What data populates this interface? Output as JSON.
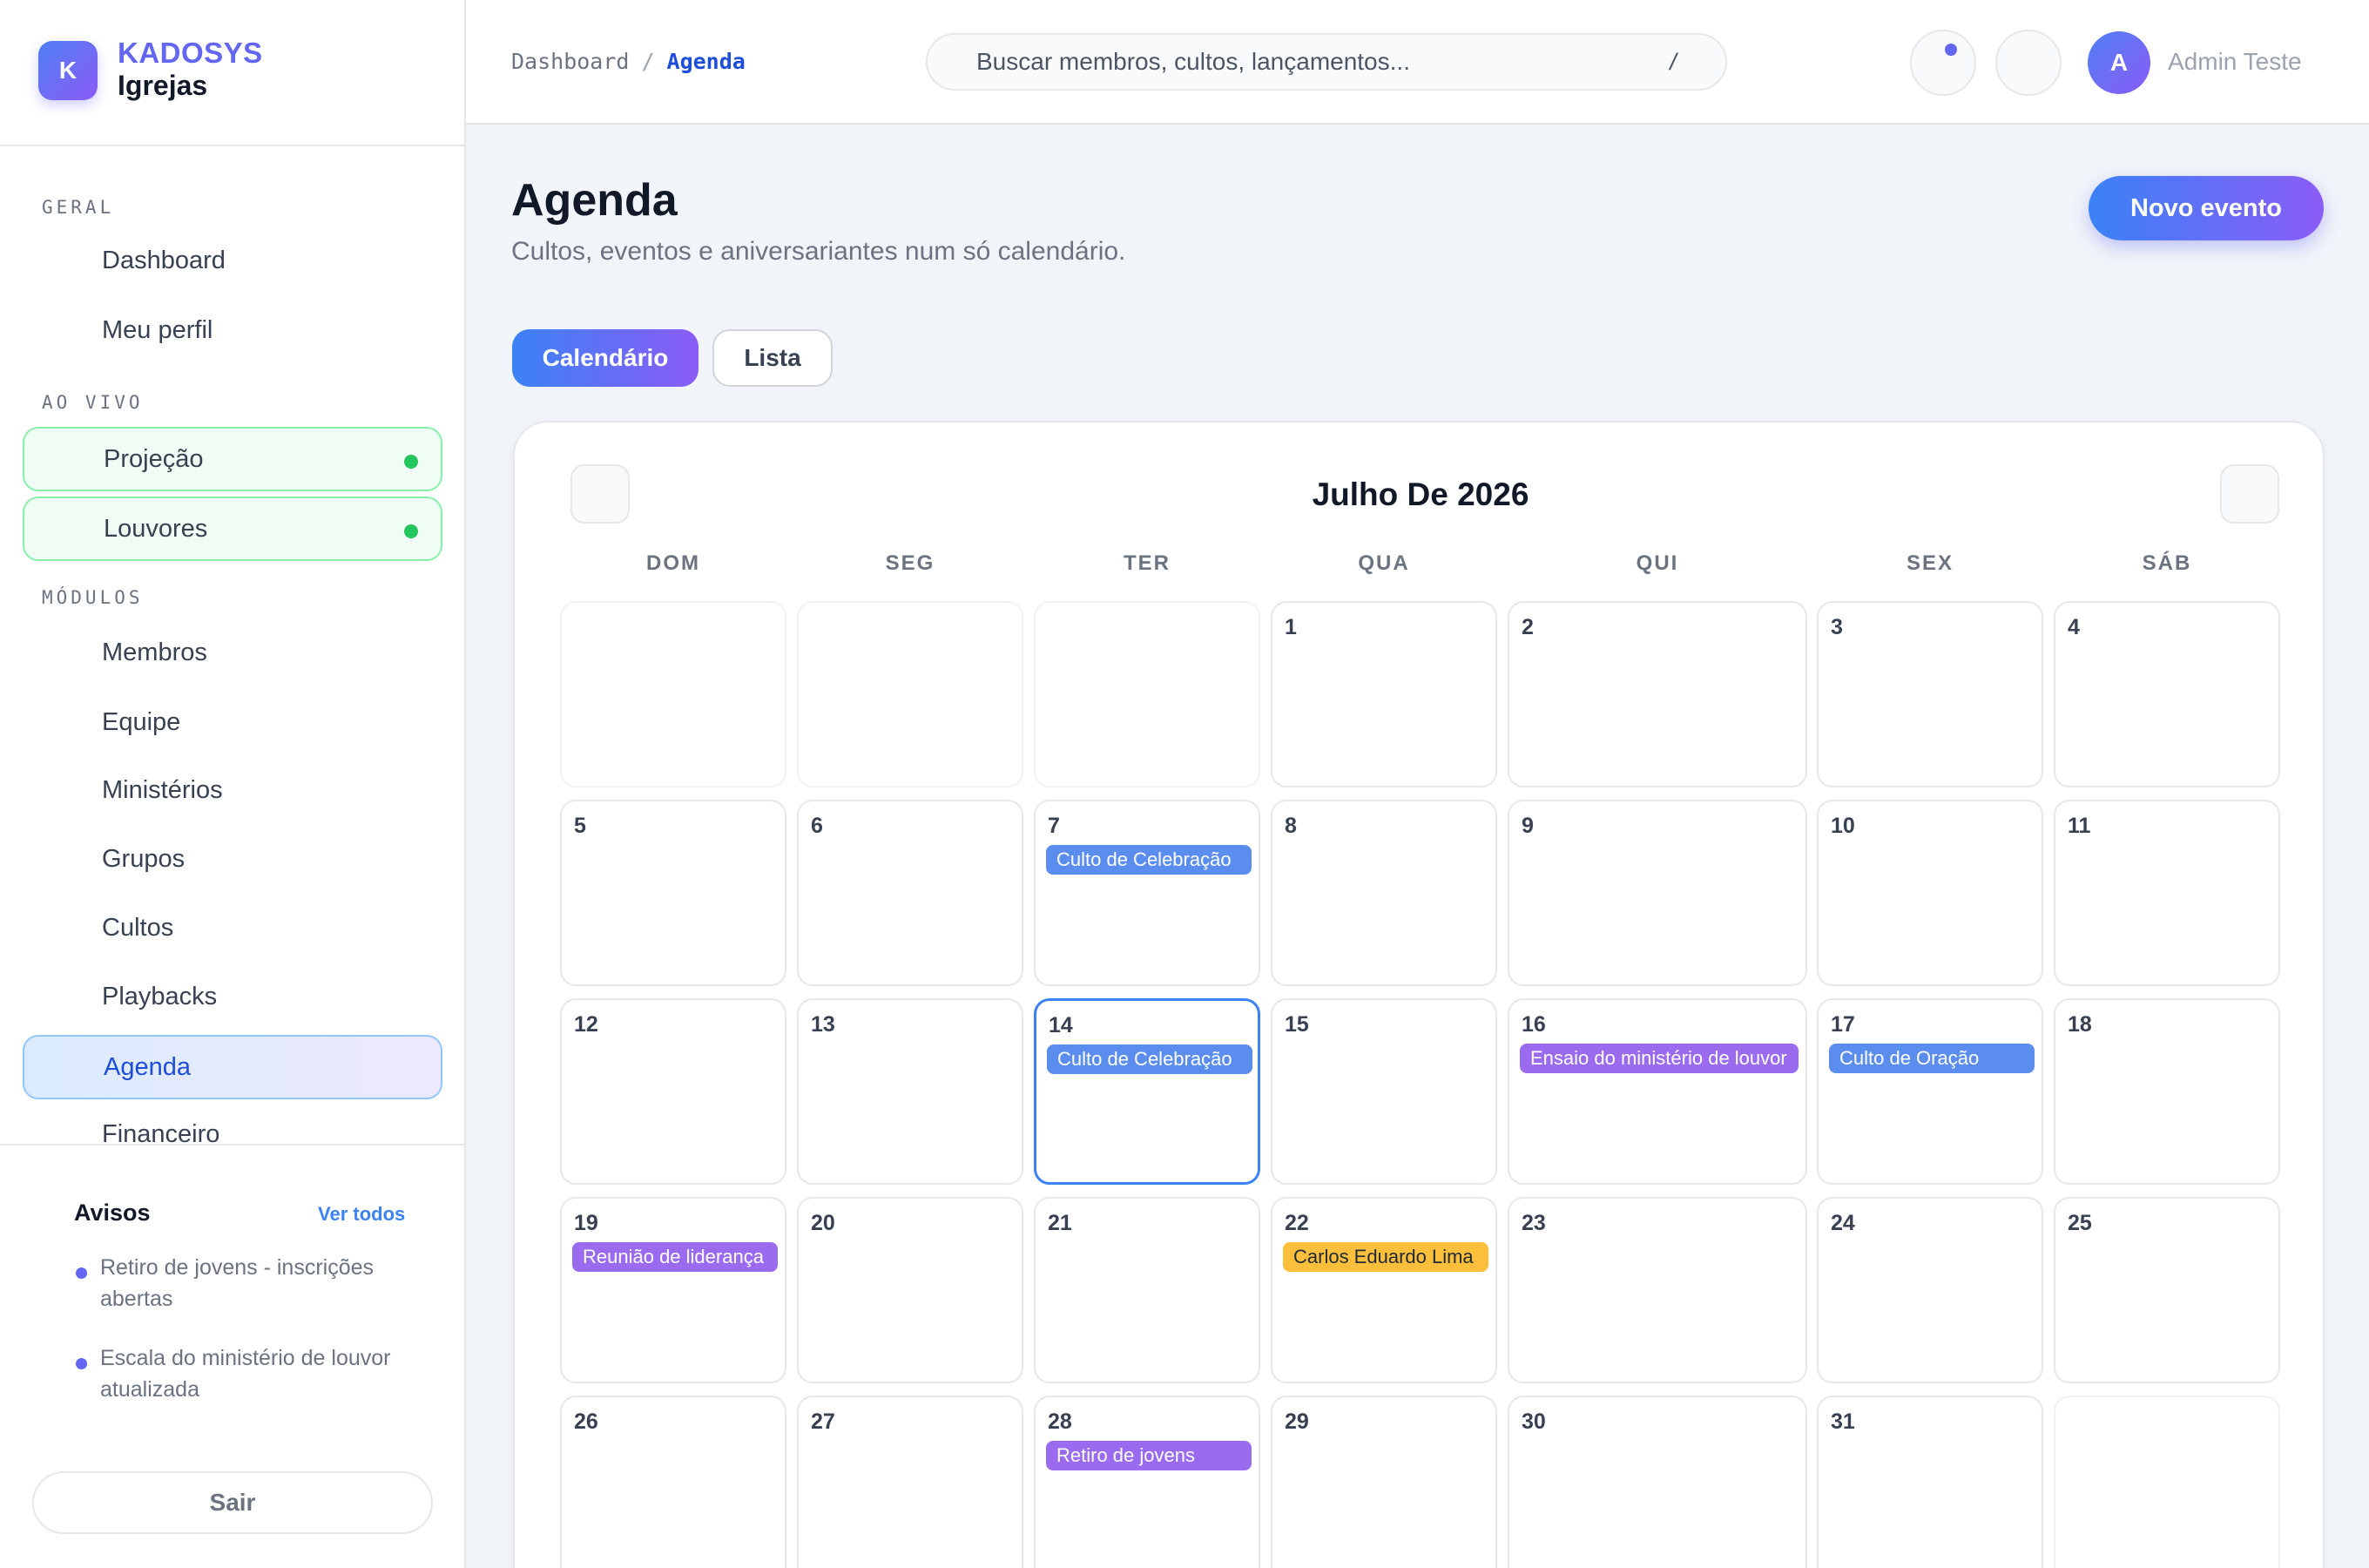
{
  "brand": {
    "logo_letter": "K",
    "name": "KADOSYS",
    "subtitle": "Igrejas"
  },
  "sidebar": {
    "sections": [
      {
        "label": "GERAL",
        "items": [
          {
            "label": "Dashboard",
            "state": "default"
          },
          {
            "label": "Meu perfil",
            "state": "default"
          }
        ]
      },
      {
        "label": "AO VIVO",
        "items": [
          {
            "label": "Projeção",
            "state": "live"
          },
          {
            "label": "Louvores",
            "state": "live"
          }
        ]
      },
      {
        "label": "MÓDULOS",
        "items": [
          {
            "label": "Membros",
            "state": "default"
          },
          {
            "label": "Equipe",
            "state": "default"
          },
          {
            "label": "Ministérios",
            "state": "default"
          },
          {
            "label": "Grupos",
            "state": "default"
          },
          {
            "label": "Cultos",
            "state": "default"
          },
          {
            "label": "Playbacks",
            "state": "default"
          },
          {
            "label": "Agenda",
            "state": "active"
          },
          {
            "label": "Financeiro",
            "state": "default"
          }
        ]
      }
    ],
    "notices": {
      "title": "Avisos",
      "see_all": "Ver todos",
      "items": [
        "Retiro de jovens - inscrições abertas",
        "Escala do ministério de louvor atualizada"
      ]
    },
    "logout_label": "Sair"
  },
  "header": {
    "breadcrumb": [
      "Dashboard",
      "Agenda"
    ],
    "breadcrumb_separator": "/",
    "search": {
      "placeholder": "Buscar membros, cultos, lançamentos...",
      "shortcut": "/"
    },
    "user": {
      "initial": "A",
      "name": "Admin Teste"
    }
  },
  "page": {
    "title": "Agenda",
    "subtitle": "Cultos, eventos e aniversariantes num só calendário.",
    "new_event_label": "Novo evento",
    "tabs": [
      {
        "label": "Calendário",
        "active": true
      },
      {
        "label": "Lista",
        "active": false
      }
    ]
  },
  "calendar": {
    "title": "Julho De 2026",
    "weekdays": [
      "DOM",
      "SEG",
      "TER",
      "QUA",
      "QUI",
      "SEX",
      "SÁB"
    ],
    "today": 14,
    "weeks": [
      [
        null,
        null,
        null,
        1,
        2,
        3,
        4
      ],
      [
        5,
        6,
        7,
        8,
        9,
        10,
        11
      ],
      [
        12,
        13,
        14,
        15,
        16,
        17,
        18
      ],
      [
        19,
        20,
        21,
        22,
        23,
        24,
        25
      ],
      [
        26,
        27,
        28,
        29,
        30,
        31,
        null
      ]
    ],
    "events": [
      {
        "day": 7,
        "title": "Culto de Celebração",
        "color": "blue"
      },
      {
        "day": 14,
        "title": "Culto de Celebração",
        "color": "blue"
      },
      {
        "day": 16,
        "title": "Ensaio do ministério de louvor",
        "color": "purple"
      },
      {
        "day": 17,
        "title": "Culto de Oração",
        "color": "blue"
      },
      {
        "day": 19,
        "title": "Reunião de liderança",
        "color": "purple"
      },
      {
        "day": 22,
        "title": "Carlos Eduardo Lima",
        "color": "yellow"
      },
      {
        "day": 28,
        "title": "Retiro de jovens",
        "color": "purple"
      }
    ]
  },
  "colors": {
    "accent": "#3b82f6",
    "accent_2": "#8b5cf6",
    "live": "#22c55e",
    "event_blue": "#5b8def",
    "event_purple": "#9b6bef",
    "event_yellow": "#fbbf3c"
  }
}
